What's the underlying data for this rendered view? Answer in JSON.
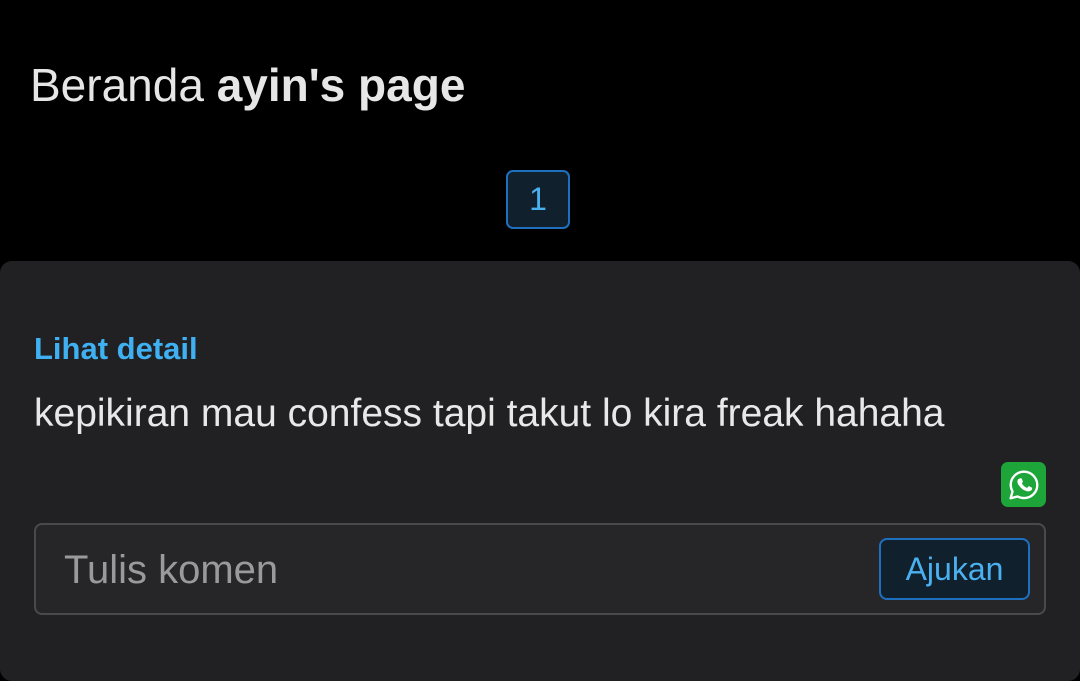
{
  "header": {
    "brand": "Beranda",
    "page_name": "ayin's page"
  },
  "pagination": {
    "current_page": "1"
  },
  "post": {
    "detail_link": "Lihat detail",
    "message": "kepikiran mau confess tapi takut lo kira freak hahaha",
    "share_icon": "whatsapp-icon",
    "share_color": "#1ea53a"
  },
  "comment": {
    "placeholder": "Tulis komen",
    "value": "",
    "submit_label": "Ajukan"
  },
  "colors": {
    "accent": "#3fb1f2",
    "background": "#000000",
    "card": "#212123"
  }
}
